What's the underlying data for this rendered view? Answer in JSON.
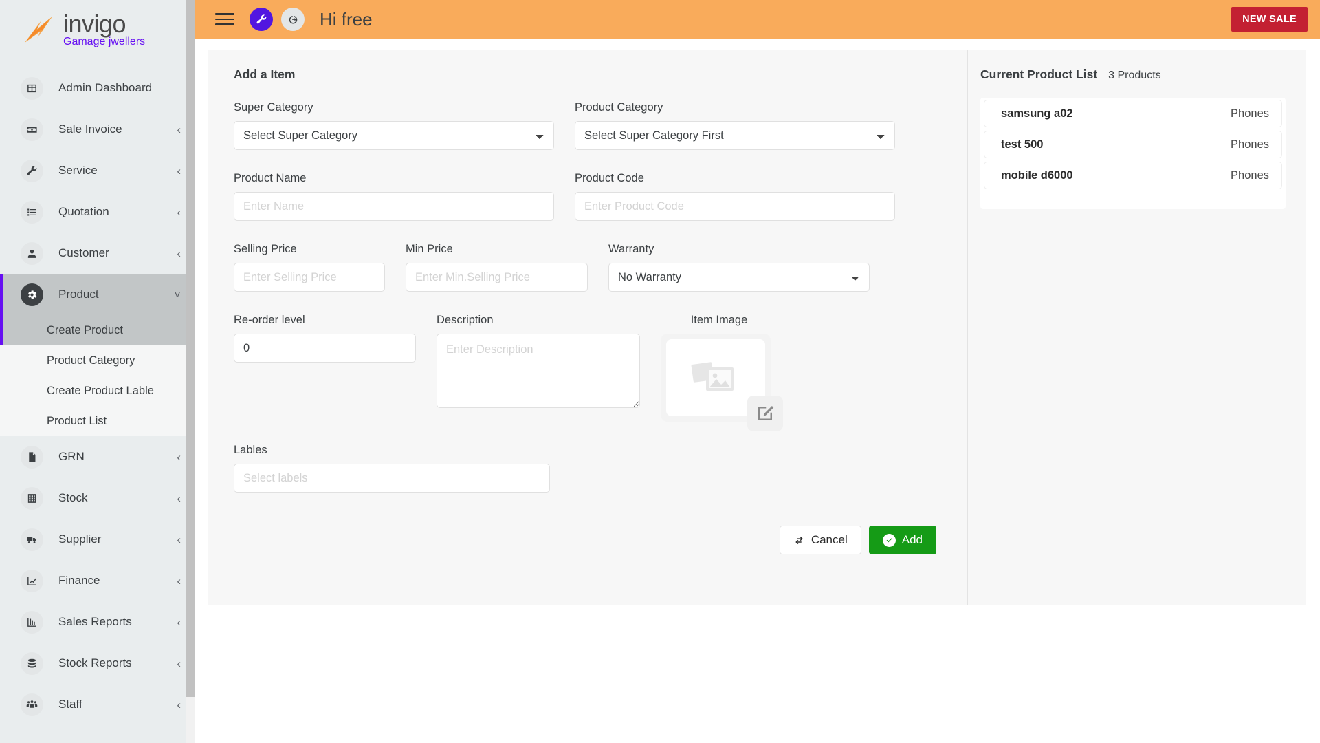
{
  "brand": {
    "name": "invigo",
    "tenant": "Gamage jwellers",
    "logo_icon": "invigo-logo-icon"
  },
  "sidebar": {
    "items": [
      {
        "label": "Admin Dashboard",
        "icon": "dashboard-grid-icon",
        "chevron": "",
        "active": false
      },
      {
        "label": "Sale Invoice",
        "icon": "money-bill-icon",
        "chevron": "‹",
        "active": false
      },
      {
        "label": "Service",
        "icon": "wrench-icon",
        "chevron": "‹",
        "active": false
      },
      {
        "label": "Quotation",
        "icon": "list-icon",
        "chevron": "‹",
        "active": false
      },
      {
        "label": "Customer",
        "icon": "person-icon",
        "chevron": "‹",
        "active": false
      },
      {
        "label": "Product",
        "icon": "gear-icon",
        "chevron": "˅",
        "active": true
      },
      {
        "label": "GRN",
        "icon": "document-icon",
        "chevron": "‹",
        "active": false
      },
      {
        "label": "Stock",
        "icon": "grid-table-icon",
        "chevron": "‹",
        "active": false
      },
      {
        "label": "Supplier",
        "icon": "truck-icon",
        "chevron": "‹",
        "active": false
      },
      {
        "label": "Finance",
        "icon": "line-chart-icon",
        "chevron": "‹",
        "active": false
      },
      {
        "label": "Sales Reports",
        "icon": "bar-chart-icon",
        "chevron": "‹",
        "active": false
      },
      {
        "label": "Stock Reports",
        "icon": "database-icon",
        "chevron": "‹",
        "active": false
      },
      {
        "label": "Staff",
        "icon": "people-group-icon",
        "chevron": "‹",
        "active": false
      }
    ],
    "product_submenu": [
      {
        "label": "Create Product",
        "active": true
      },
      {
        "label": "Product Category",
        "active": false
      },
      {
        "label": "Create Product Lable",
        "active": false
      },
      {
        "label": "Product List",
        "active": false
      }
    ]
  },
  "topbar": {
    "menu_icon": "hamburger-menu-icon",
    "settings_icon": "wrench-icon",
    "logout_icon": "logout-icon",
    "greeting": "Hi free",
    "new_sale_label": "NEW SALE",
    "bg_color": "#f9ab5b",
    "new_sale_color": "#c32032",
    "settings_color": "#5216e0"
  },
  "form": {
    "title": "Add a Item",
    "super_category": {
      "label": "Super Category",
      "value": "Select Super Category",
      "options": [
        "Select Super Category"
      ]
    },
    "product_category": {
      "label": "Product Category",
      "value": "Select Super Category First",
      "options": [
        "Select Super Category First"
      ]
    },
    "product_name": {
      "label": "Product Name",
      "value": "",
      "placeholder": "Enter Name"
    },
    "product_code": {
      "label": "Product Code",
      "value": "",
      "placeholder": "Enter Product Code"
    },
    "selling_price": {
      "label": "Selling Price",
      "value": "",
      "placeholder": "Enter Selling Price"
    },
    "min_price": {
      "label": "Min Price",
      "value": "",
      "placeholder": "Enter Min.Selling Price"
    },
    "warranty": {
      "label": "Warranty",
      "value": "No Warranty",
      "options": [
        "No Warranty"
      ]
    },
    "reorder_level": {
      "label": "Re-order level",
      "value": "0"
    },
    "description": {
      "label": "Description",
      "value": "",
      "placeholder": "Enter Description"
    },
    "item_image": {
      "label": "Item Image",
      "placeholder_icon": "image-placeholder-icon",
      "edit_icon": "edit-pencil-square-icon"
    },
    "lables": {
      "label": "Lables",
      "value": "",
      "placeholder": "Select labels"
    },
    "cancel_label": "Cancel",
    "cancel_icon": "refresh-cycle-icon",
    "add_label": "Add",
    "add_icon": "check-circle-icon",
    "add_color": "#159b16"
  },
  "product_list": {
    "title": "Current Product List",
    "count_label": "3 Products",
    "rows": [
      {
        "name": "samsung a02",
        "category": "Phones"
      },
      {
        "name": "test 500",
        "category": "Phones"
      },
      {
        "name": "mobile d6000",
        "category": "Phones"
      }
    ]
  }
}
